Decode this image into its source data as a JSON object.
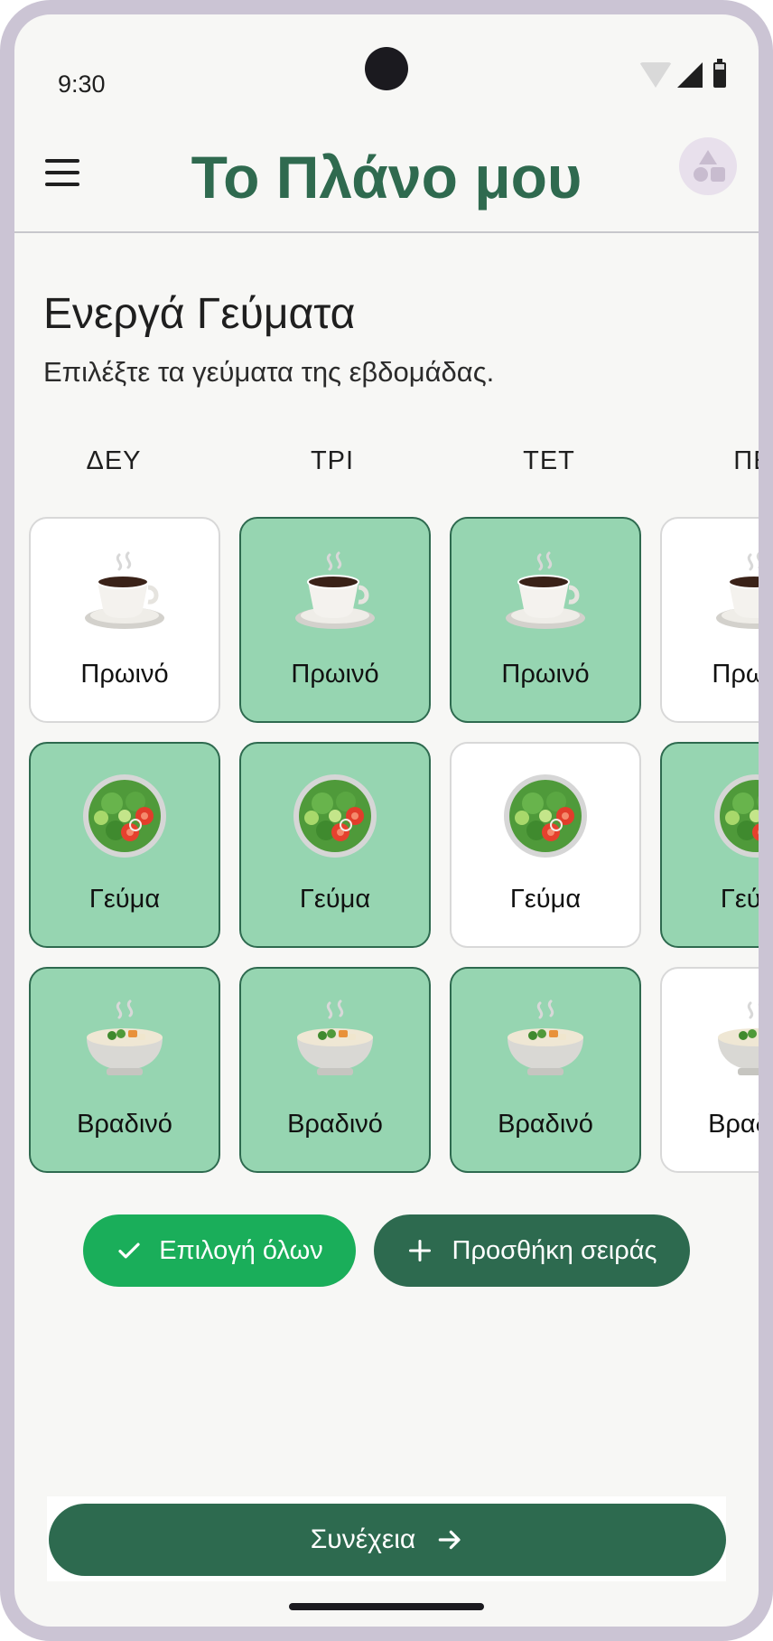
{
  "status": {
    "time": "9:30"
  },
  "header": {
    "title": "Το Πλάνο μου"
  },
  "section": {
    "title": "Ενεργά Γεύματα",
    "subtitle": "Επιλέξτε τα γεύματα της εβδομάδας."
  },
  "days": [
    "ΔΕΥ",
    "ΤΡΙ",
    "ΤΕΤ",
    "ΠΕΜ"
  ],
  "meals": [
    {
      "label": "Πρωινό",
      "icon": "coffee-cup-icon",
      "selected": [
        false,
        true,
        true,
        false
      ]
    },
    {
      "label": "Γεύμα",
      "icon": "salad-bowl-icon",
      "selected": [
        true,
        true,
        false,
        true
      ]
    },
    {
      "label": "Βραδινό",
      "icon": "soup-bowl-icon",
      "selected": [
        true,
        true,
        true,
        false
      ]
    }
  ],
  "actions": {
    "select_all": "Επιλογή όλων",
    "add_row": "Προσθήκη σειράς",
    "continue": "Συνέχεια"
  },
  "colors": {
    "brand": "#2d6a4f",
    "selected_card": "#96d5b1",
    "select_all_button": "#1aae5a"
  }
}
